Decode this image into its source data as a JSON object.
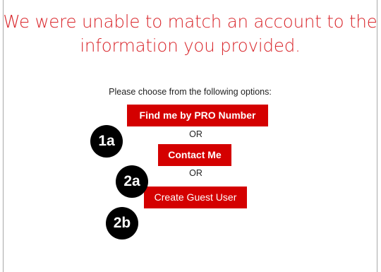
{
  "headline": {
    "line1": "We were unable to match an account to the",
    "line2": "information you provided."
  },
  "prompt": "Please choose from the following options:",
  "options": {
    "find_by_pro": "Find me by PRO Number",
    "or_1": "OR",
    "contact_me": "Contact Me",
    "or_2": "OR",
    "create_guest": "Create Guest User"
  },
  "annotations": {
    "badge_1": "1a",
    "badge_2": "2a",
    "badge_3": "2b"
  },
  "colors": {
    "headline": "#d9262b",
    "button_bg": "#d40000",
    "button_text": "#ffffff",
    "badge_bg": "#000000"
  }
}
